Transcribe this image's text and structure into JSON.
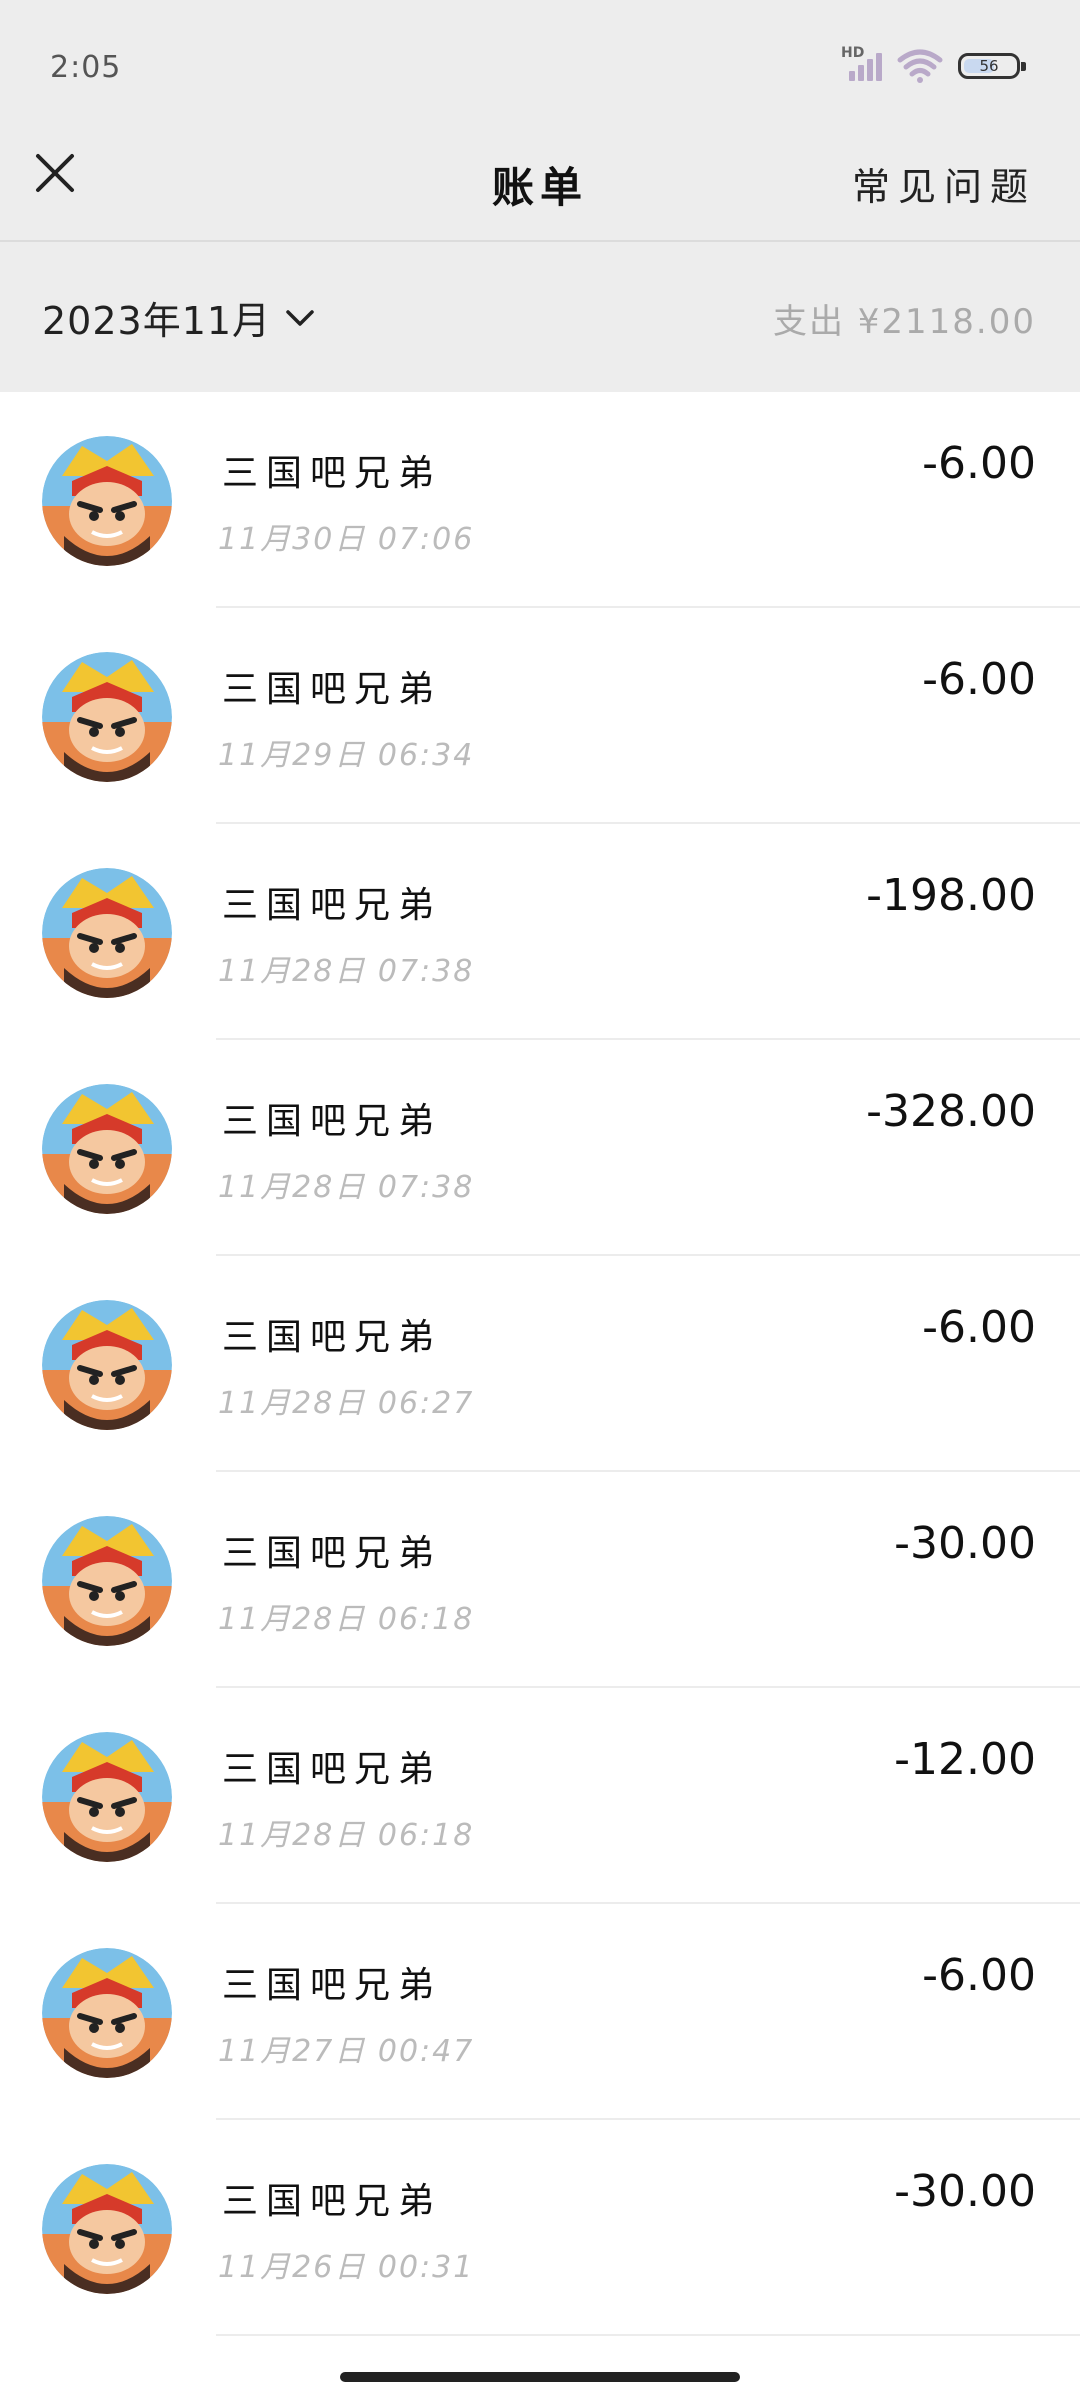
{
  "status_bar": {
    "time": "2:05",
    "network_label": "HD",
    "battery_level": "56"
  },
  "nav": {
    "title": "账单",
    "faq_label": "常见问题"
  },
  "summary": {
    "month": "2023年11月",
    "spend_text": "支出 ¥2118.00"
  },
  "transactions": [
    {
      "merchant": "三国吧兄弟",
      "time": "11月30日 07:06",
      "amount": "-6.00"
    },
    {
      "merchant": "三国吧兄弟",
      "time": "11月29日 06:34",
      "amount": "-6.00"
    },
    {
      "merchant": "三国吧兄弟",
      "time": "11月28日 07:38",
      "amount": "-198.00"
    },
    {
      "merchant": "三国吧兄弟",
      "time": "11月28日 07:38",
      "amount": "-328.00"
    },
    {
      "merchant": "三国吧兄弟",
      "time": "11月28日 06:27",
      "amount": "-6.00"
    },
    {
      "merchant": "三国吧兄弟",
      "time": "11月28日 06:18",
      "amount": "-30.00"
    },
    {
      "merchant": "三国吧兄弟",
      "time": "11月28日 06:18",
      "amount": "-12.00"
    },
    {
      "merchant": "三国吧兄弟",
      "time": "11月27日 00:47",
      "amount": "-6.00"
    },
    {
      "merchant": "三国吧兄弟",
      "time": "11月26日 00:31",
      "amount": "-30.00"
    }
  ],
  "colors": {
    "header_bg": "#ededed",
    "text_primary": "#111111",
    "text_secondary": "#bbbbbb"
  }
}
